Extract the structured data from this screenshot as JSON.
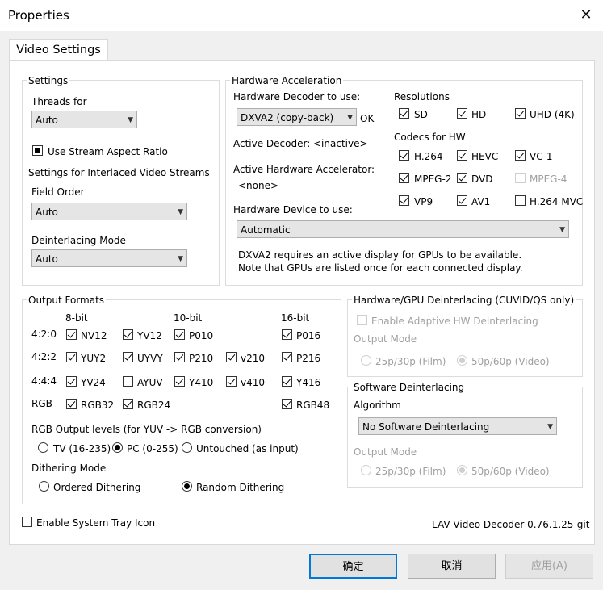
{
  "window": {
    "title": "Properties",
    "close_glyph": "✕"
  },
  "tab": "Video Settings",
  "settings": {
    "title": "Settings",
    "threads_label": "Threads for",
    "threads_value": "Auto",
    "stream_aspect": "Use Stream Aspect Ratio",
    "interlaced_label": "Settings for Interlaced Video Streams",
    "field_order_label": "Field Order",
    "field_order_value": "Auto",
    "deint_mode_label": "Deinterlacing Mode",
    "deint_mode_value": "Auto"
  },
  "hw": {
    "title": "Hardware Acceleration",
    "decoder_label": "Hardware Decoder to use:",
    "decoder_value": "DXVA2 (copy-back)",
    "decoder_status": "OK",
    "active_decoder_label": "Active Decoder:",
    "active_decoder_value": "<inactive>",
    "active_accel_label": "Active Hardware Accelerator:",
    "active_accel_value": "<none>",
    "device_label": "Hardware Device to use:",
    "device_value": "Automatic",
    "note_line1": "DXVA2 requires an active display for GPUs to be available.",
    "note_line2": "Note that GPUs are listed once for each connected display.",
    "resolutions_label": "Resolutions",
    "res_sd": "SD",
    "res_hd": "HD",
    "res_uhd": "UHD (4K)",
    "codecs_label": "Codecs for HW",
    "c_h264": "H.264",
    "c_hevc": "HEVC",
    "c_vc1": "VC-1",
    "c_mpeg2": "MPEG-2",
    "c_dvd": "DVD",
    "c_mpeg4": "MPEG-4",
    "c_vp9": "VP9",
    "c_av1": "AV1",
    "c_h264mvc": "H.264 MVC"
  },
  "output": {
    "title": "Output Formats",
    "h_8bit": "8-bit",
    "h_10bit": "10-bit",
    "h_16bit": "16-bit",
    "r_420": "4:2:0",
    "r_422": "4:2:2",
    "r_444": "4:4:4",
    "r_rgb": "RGB",
    "nv12": "NV12",
    "yv12": "YV12",
    "p010": "P010",
    "p016": "P016",
    "yuy2": "YUY2",
    "uyvy": "UYVY",
    "p210": "P210",
    "v210": "v210",
    "p216": "P216",
    "yv24": "YV24",
    "ayuv": "AYUV",
    "y410": "Y410",
    "v410": "v410",
    "y416": "Y416",
    "rgb32": "RGB32",
    "rgb24": "RGB24",
    "rgb48": "RGB48",
    "levels_label": "RGB Output levels (for YUV -> RGB conversion)",
    "lv_tv": "TV (16-235)",
    "lv_pc": "PC (0-255)",
    "lv_untouched": "Untouched (as input)",
    "dither_label": "Dithering Mode",
    "d_ordered": "Ordered Dithering",
    "d_random": "Random Dithering"
  },
  "hwdeint": {
    "title": "Hardware/GPU Deinterlacing (CUVID/QS only)",
    "enable": "Enable Adaptive HW Deinterlacing",
    "mode_label": "Output Mode",
    "film": "25p/30p (Film)",
    "video": "50p/60p (Video)"
  },
  "swdeint": {
    "title": "Software Deinterlacing",
    "algo_label": "Algorithm",
    "algo_value": "No Software Deinterlacing",
    "mode_label": "Output Mode",
    "film": "25p/30p (Film)",
    "video": "50p/60p (Video)"
  },
  "footer": {
    "tray": "Enable System Tray Icon",
    "version": "LAV Video Decoder 0.76.1.25-git"
  },
  "buttons": {
    "ok": "确定",
    "cancel": "取消",
    "apply": "应用(A)"
  }
}
